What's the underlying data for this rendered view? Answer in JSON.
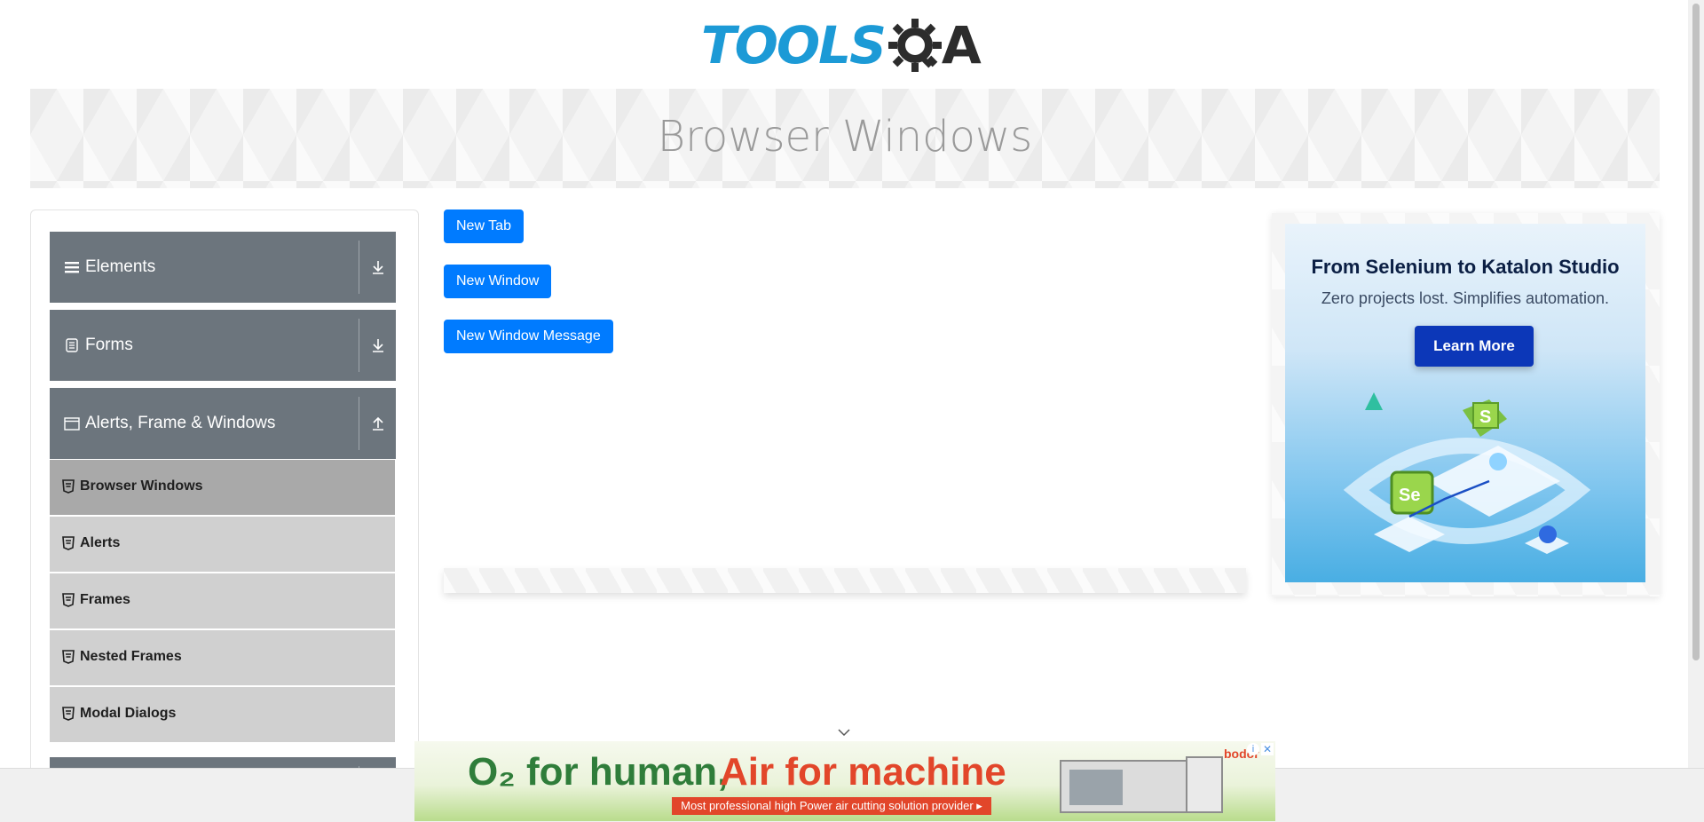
{
  "header": {
    "logo_text": "TOOLS",
    "logo_text_suffix": "A"
  },
  "banner": {
    "title": "Browser Windows"
  },
  "sidebar": {
    "groups": [
      {
        "label": "Elements",
        "icon": "list-icon",
        "state": "collapsed"
      },
      {
        "label": "Forms",
        "icon": "document-icon",
        "state": "collapsed"
      },
      {
        "label": "Alerts, Frame & Windows",
        "icon": "window-icon",
        "state": "expanded"
      }
    ],
    "items": [
      {
        "label": "Browser Windows",
        "active": true
      },
      {
        "label": "Alerts",
        "active": false
      },
      {
        "label": "Frames",
        "active": false
      },
      {
        "label": "Nested Frames",
        "active": false
      },
      {
        "label": "Modal Dialogs",
        "active": false
      }
    ]
  },
  "main": {
    "buttons": {
      "new_tab": "New Tab",
      "new_window": "New Window",
      "new_window_message": "New Window Message"
    }
  },
  "right_ad": {
    "title": "From Selenium to Katalon Studio",
    "subtitle": "Zero projects lost. Simplifies automation.",
    "cta": "Learn More"
  },
  "bottom_ad": {
    "headline_a": "O₂ for human,",
    "headline_b": "Air for machine",
    "strip": "Most professional high Power air cutting solution provider ▸",
    "brand": "bodor"
  },
  "colors": {
    "primary_button": "#007bff",
    "sidebar_group": "#6c757d",
    "sidebar_item": "#d0d0d0",
    "sidebar_item_active": "#a9a9a9",
    "logo_blue": "#1c9ad6"
  }
}
